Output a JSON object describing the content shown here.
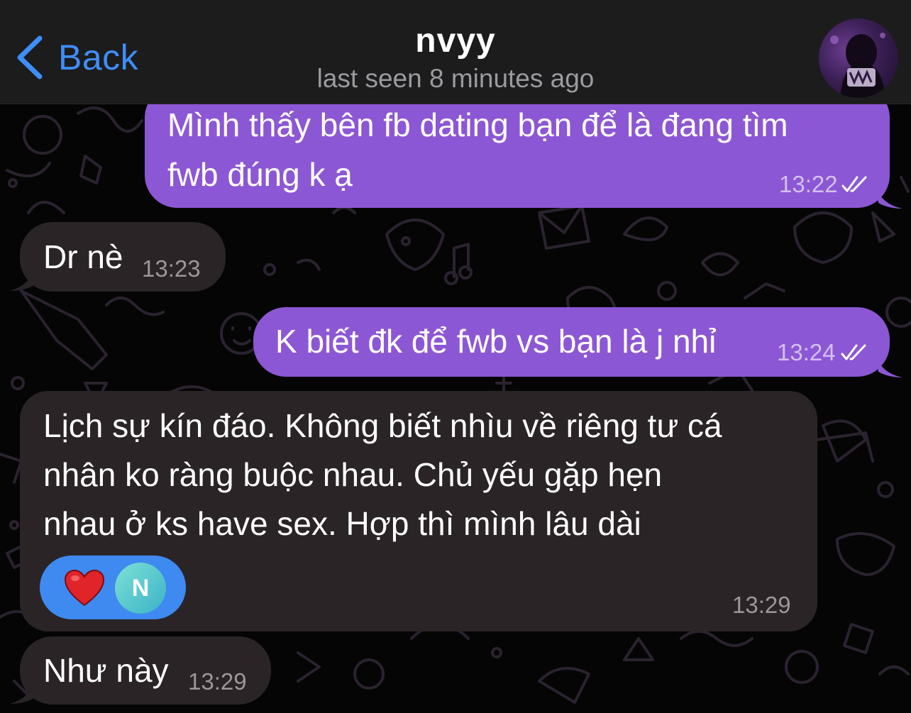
{
  "header": {
    "back_label": "Back",
    "contact_name": "nvyy",
    "status": "last seen 8 minutes ago"
  },
  "messages": [
    {
      "direction": "outgoing",
      "lines": [
        "Mình thấy bên fb dating bạn để là đang tìm",
        "fwb đúng k ạ"
      ],
      "time": "13:22",
      "read": true
    },
    {
      "direction": "incoming",
      "lines": [
        "Dr nè"
      ],
      "time": "13:23"
    },
    {
      "direction": "outgoing",
      "lines": [
        "K biết đk để fwb vs bạn là j nhỉ"
      ],
      "time": "13:24",
      "read": true
    },
    {
      "direction": "incoming",
      "lines": [
        "Lịch sự kín đáo. Không biết nhìu về riêng tư cá",
        "nhân ko ràng buộc nhau. Chủ yếu gặp hẹn",
        "nhau ở ks have sex. Hợp thì mình lâu dài"
      ],
      "time": "13:29",
      "reaction": {
        "emoji": "heart-icon",
        "reactor_initial": "N"
      }
    },
    {
      "direction": "incoming",
      "lines": [
        "Như này"
      ],
      "time": "13:29"
    }
  ],
  "colors": {
    "outgoing_bubble": "#8c57d4",
    "incoming_bubble": "#2a2427",
    "accent": "#3e8ef7",
    "reaction_pill": "#3e8af0"
  }
}
